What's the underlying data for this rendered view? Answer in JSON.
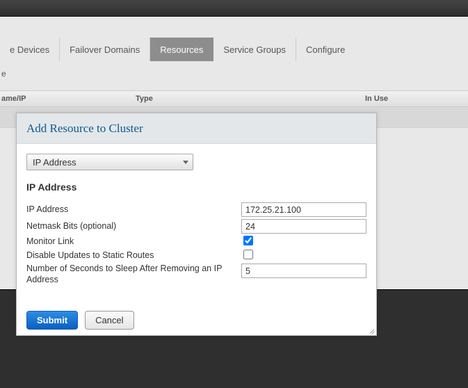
{
  "tabs": {
    "t0": "e Devices",
    "t1": "Failover Domains",
    "t2": "Resources",
    "t3": "Service Groups",
    "t4": "Configure"
  },
  "breadcrumb": "e",
  "columns": {
    "c0": "ame/IP",
    "c1": "Type",
    "c2": "In Use"
  },
  "modal": {
    "title": "Add Resource to Cluster",
    "type_selected": "IP Address",
    "section": "IP Address",
    "labels": {
      "ip": "IP Address",
      "netmask": "Netmask Bits (optional)",
      "monitor": "Monitor Link",
      "disable": "Disable Updates to Static Routes",
      "sleep": "Number of Seconds to Sleep After Removing an IP Address"
    },
    "values": {
      "ip": "172.25.21.100",
      "netmask": "24",
      "monitor_checked": true,
      "disable_checked": false,
      "sleep": "5"
    },
    "buttons": {
      "submit": "Submit",
      "cancel": "Cancel"
    }
  }
}
